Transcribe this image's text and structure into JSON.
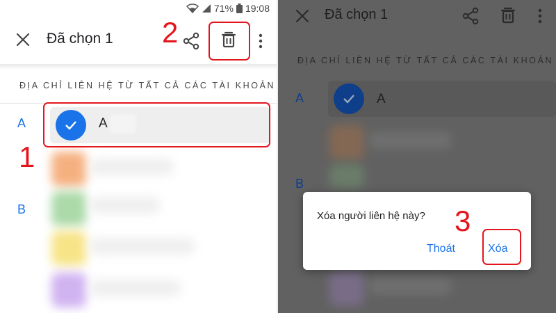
{
  "colors": {
    "accent": "#1a73e8",
    "annotation": "#e3161e",
    "scrim": "#616161"
  },
  "status_bar": {
    "battery": "71%",
    "time": "19:08",
    "icons": [
      "wifi-icon",
      "signal-icon",
      "battery-icon"
    ]
  },
  "app_bar": {
    "title": "Đã chọn 1",
    "close_icon": "close-icon",
    "share_icon": "share-icon",
    "delete_icon": "trash-icon",
    "more_icon": "more-vert-icon"
  },
  "contacts": {
    "section_header": "ĐỊA CHỈ LIÊN HỆ TỪ TẤT CẢ CÁC TÀI KHOẢN",
    "groups": [
      {
        "letter": "A"
      },
      {
        "letter": "B"
      }
    ],
    "selected_contact": {
      "name": "A"
    }
  },
  "annotations": {
    "step1": "1",
    "step2": "2",
    "step3": "3"
  },
  "dialog": {
    "message": "Xóa người liên hệ này?",
    "cancel_label": "Thoát",
    "confirm_label": "Xóa"
  }
}
